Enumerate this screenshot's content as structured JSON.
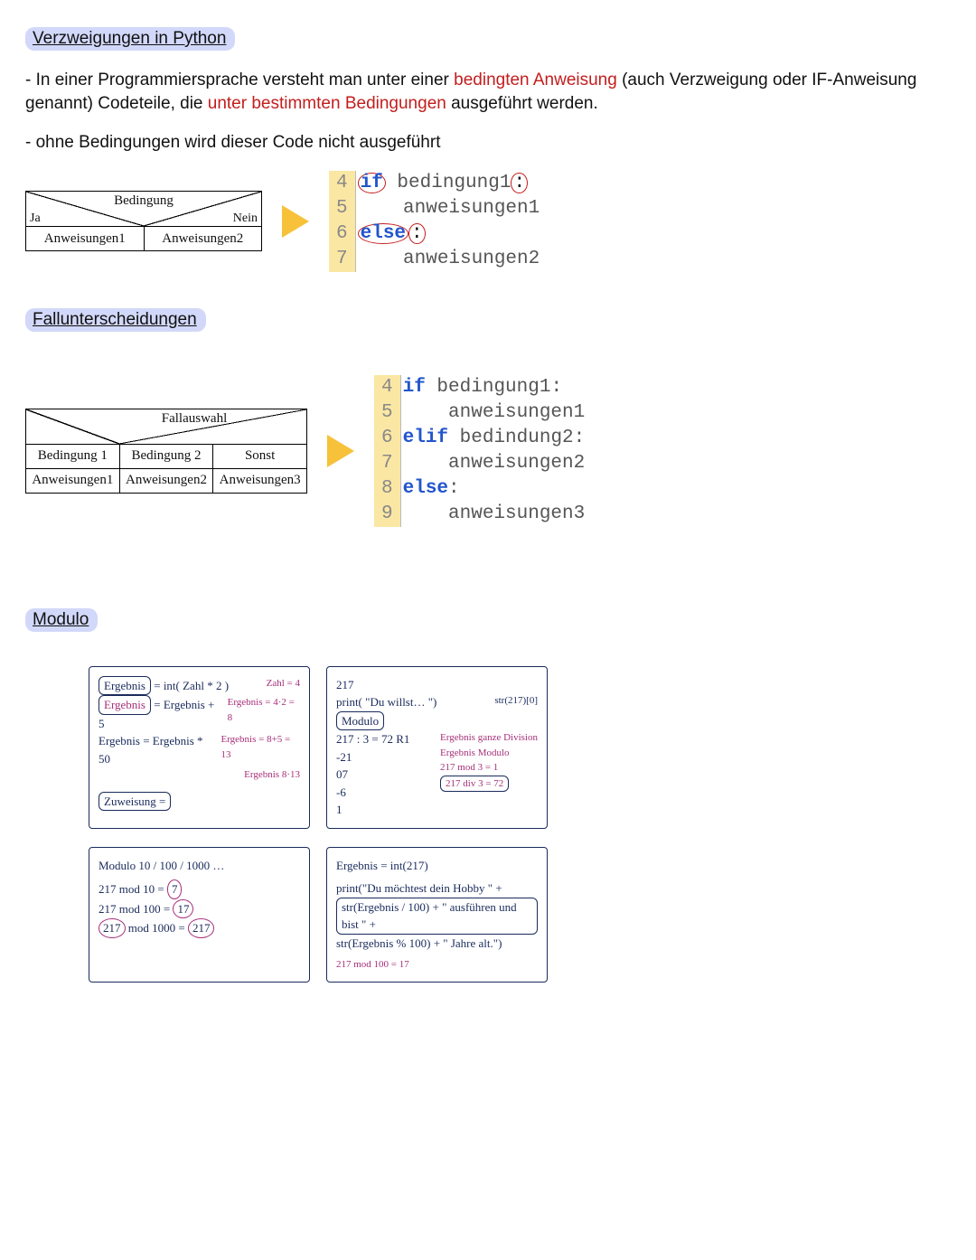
{
  "sections": {
    "h1": "Verzweigungen in Python",
    "p1a": "- In einer Programmiersprache versteht man unter einer ",
    "p1b": "bedingten Anweisung",
    "p1c": " (auch Verzweigung oder IF-Anweisung genannt) Codeteile, die ",
    "p1d": "unter bestimmten Bedingungen",
    "p1e": " ausgeführt werden.",
    "p2": "- ohne Bedingungen wird dieser Code nicht ausgeführt",
    "h2": "Fallunterscheidungen",
    "h3": "Modulo"
  },
  "diag1": {
    "title": "Bedingung",
    "yes": "Ja",
    "no": "Nein",
    "left": "Anweisungen1",
    "right": "Anweisungen2"
  },
  "code1": {
    "lines": [
      "4",
      "5",
      "6",
      "7"
    ],
    "l0_kw": "if",
    "l0_rest": " bedingung1",
    "colon": ":",
    "l1": "    anweisungen1",
    "l2_kw": "else",
    "l3": "    anweisungen2"
  },
  "diag2": {
    "title": "Fallauswahl",
    "c1": "Bedingung 1",
    "c2": "Bedingung 2",
    "c3": "Sonst",
    "a1": "Anweisungen1",
    "a2": "Anweisungen2",
    "a3": "Anweisungen3"
  },
  "code2": {
    "lines": [
      "4",
      "5",
      "6",
      "7",
      "8",
      "9"
    ],
    "l0_kw": "if",
    "l0_rest": " bedingung1:",
    "l1": "    anweisungen1",
    "l2_kw": "elif",
    "l2_rest": " bedindung2:",
    "l3": "    anweisungen2",
    "l4_kw": "else",
    "l4_rest": ":",
    "l5": "    anweisungen3"
  },
  "hand": {
    "b1": {
      "l1a": "Ergebnis",
      "l1b": " = int( Zahl * 2 )",
      "side1": "Zahl = 4",
      "l2a": "Ergebnis",
      "l2b": " = Ergebnis + 5",
      "side2": "Ergebnis = 4·2 = 8",
      "side3": "Ergebnis = 8+5 = 13",
      "l3": "Ergebnis = Ergebnis * 50",
      "side4": "Ergebnis 8·13",
      "l4a": "Zuweisung =",
      "l4b": ""
    },
    "b2": {
      "l1": "217",
      "l2a": "print( \"Du willst… \")",
      "l2b": "str(217)[0]",
      "l3": "Modulo",
      "l4": "217 : 3 = 72 R1",
      "l5": "-21",
      "l6": "  07",
      "side1": "Ergebnis ganze Division",
      "side2": "Ergebnis Modulo",
      "l7": "  -6",
      "l8": "   1",
      "foot1": "217 mod 3 = 1",
      "foot2": "217 div 3 = 72"
    },
    "b3": {
      "l1": "Modulo 10 / 100 / 1000 …",
      "l2a": "217",
      "l2b": " mod 10 = ",
      "l2c": "7",
      "l3a": "217",
      "l3b": " mod 100 = ",
      "l3c": "17",
      "l4a": "217",
      "l4b": " mod 1000 = ",
      "l4c": "217"
    },
    "b4": {
      "l1": "Ergebnis = int(217)",
      "l2": "print(\"Du möchtest dein Hobby \" +",
      "l3": "str(Ergebnis / 100) + \" ausführen und bist \" +",
      "l4": "str(Ergebnis % 100) + \" Jahre alt.\")",
      "foot": "217 mod 100 = 17"
    }
  }
}
